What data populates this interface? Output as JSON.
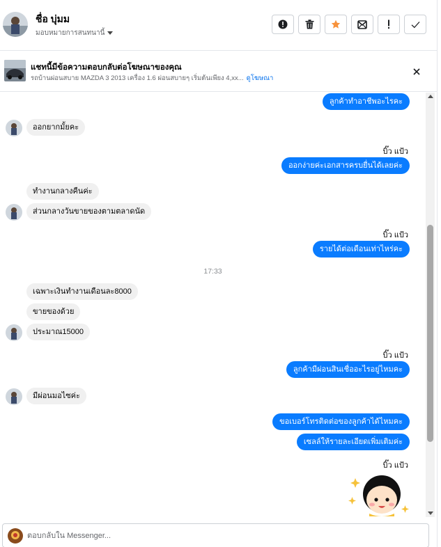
{
  "header": {
    "contact_name": "ชื่อ บุ่มม",
    "assign_label": "มอบหมายการสนทนานี้",
    "actions": [
      {
        "icon": "alert-circle-icon",
        "name": "mark-spam-button"
      },
      {
        "icon": "trash-icon",
        "name": "delete-button"
      },
      {
        "icon": "star-icon",
        "name": "star-button"
      },
      {
        "icon": "mark-unread-icon",
        "name": "mark-unread-button"
      },
      {
        "icon": "exclamation-icon",
        "name": "follow-up-button"
      },
      {
        "icon": "check-icon",
        "name": "mark-done-button"
      }
    ],
    "star_color": "#f7923b"
  },
  "ad_banner": {
    "title": "แชทนี้มีข้อความตอบกลับต่อโฆษณาของคุณ",
    "subtitle": "รถบ้านผ่อนสบาย MAZDA 3 2013 เครื่อง 1.6 ผ่อนสบายๆ เริ่มต้นเพียง 4,xx...",
    "link": "ดูโฆษณา"
  },
  "conversation": {
    "page_sender_name": "บิ๊ว แป้ว",
    "messages": [
      {
        "dir": "out",
        "text": "ลูกค้าทำอาชีพอะไรคะ"
      },
      {
        "dir": "in",
        "text": "ออกยากมั้ยคะ"
      },
      {
        "dir": "out",
        "text": "ออกง่ายค่ะเอกสารครบยื่นได้เลยค่ะ"
      },
      {
        "dir": "in",
        "text": "ทำงานกลางคืนค่ะ"
      },
      {
        "dir": "in",
        "text": "ส่วนกลางวันขายของตามตลาดนัด"
      },
      {
        "dir": "out",
        "text": "รายได้ต่อเดือนเท่าไหร่คะ"
      },
      {
        "dir": "in",
        "text": "เฉพาะเงินทำงานเดือนละ8000"
      },
      {
        "dir": "in",
        "text": "ขายของด้วย"
      },
      {
        "dir": "in",
        "text": "ประมาณ15000"
      },
      {
        "dir": "out",
        "text": "ลูกค้ามีผ่อนสินเชื่ออะไรอยู่ไหมคะ"
      },
      {
        "dir": "in",
        "text": "มีผ่อนมอไซค่ะ"
      },
      {
        "dir": "out",
        "text": "ขอเบอร์โทรติดต่อของลูกค้าได้ไหมคะ"
      },
      {
        "dir": "out",
        "text": "เซลล์ให้รายละเอียดเพิ่มเติมค่ะ"
      }
    ],
    "timestamp": "17:33",
    "sticker_icon": "girl-sticker-icon"
  },
  "composer": {
    "placeholder": "ตอบกลับใน Messenger..."
  },
  "colors": {
    "outgoing_bubble": "#0a7cff",
    "incoming_bubble": "#f0f0f0",
    "link": "#0571ed"
  }
}
